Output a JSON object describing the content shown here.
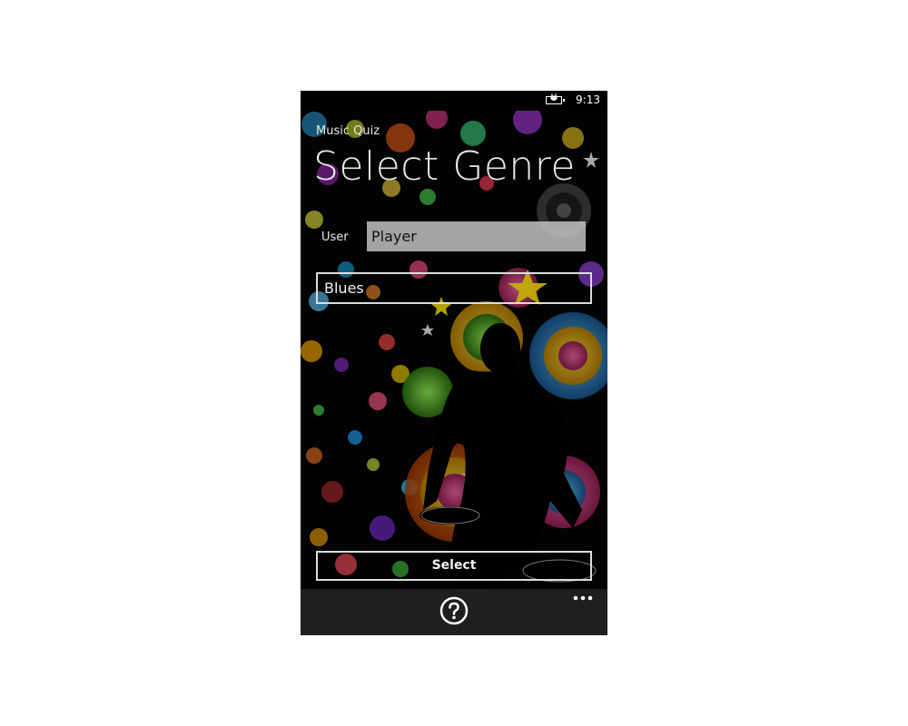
{
  "status_bar": {
    "time": "9:13",
    "battery_icon": "battery-charging-icon"
  },
  "app": {
    "title": "Music Quiz"
  },
  "page": {
    "title": "Select Genre"
  },
  "user_field": {
    "label": "User",
    "value": "Player"
  },
  "genre_picker": {
    "selected": "Blues"
  },
  "select_button": {
    "label": "Select"
  },
  "app_bar": {
    "help_icon": "question-circle-icon",
    "more_icon": "ellipsis-icon"
  }
}
